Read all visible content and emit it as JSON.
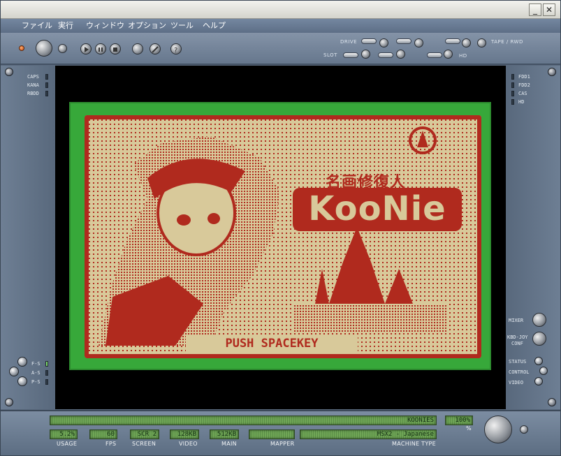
{
  "window": {
    "minimize_label": "_",
    "close_label": "✕"
  },
  "menu": [
    "ファイル",
    "実行",
    "ウィンドウ",
    "オプション",
    "ツール",
    "ヘルプ"
  ],
  "toolbar": {
    "drive_label": "DRIVE",
    "slot_label": "SLOT",
    "tape_label": "TAPE / RWD",
    "hd_label": "HD"
  },
  "left_indicators": {
    "caps": "CAPS",
    "kana": "KANA",
    "rbdd": "RBDD"
  },
  "left_bottom": {
    "fs": "F-S",
    "as": "A-S",
    "ps": "P-S"
  },
  "right_indicators": {
    "fdd1": "FDD1",
    "fdd2": "FDD2",
    "cas": "CAS",
    "hd": "HD"
  },
  "right_controls": {
    "mixer": "MIXER",
    "kbd_joy": "KBD-JOY",
    "conf": "CONF",
    "status": "STATUS",
    "control": "CONTROL",
    "video": "VIDEO"
  },
  "game": {
    "subtitle": "名画修復人",
    "title": "KooNie",
    "prompt": "PUSH SPACEKEY",
    "colors": {
      "border": "#37a83a",
      "bg": "#d8c99a",
      "ink": "#b02a1e"
    }
  },
  "status": {
    "title_value": "KOONIES",
    "usage": {
      "value": "5.2%",
      "label": "USAGE"
    },
    "fps": {
      "value": "60",
      "label": "FPS"
    },
    "screen": {
      "value": "SCR 2",
      "label": "SCREEN"
    },
    "video": {
      "value": "128KB",
      "label": "VIDEO"
    },
    "main": {
      "value": "512KB",
      "label": "MAIN"
    },
    "mapper": {
      "value": "",
      "label": "MAPPER"
    },
    "machine": {
      "value": "MSX2 - Japanese",
      "label": "MACHINE TYPE"
    },
    "volume": {
      "value": "100%",
      "label": "%"
    }
  }
}
